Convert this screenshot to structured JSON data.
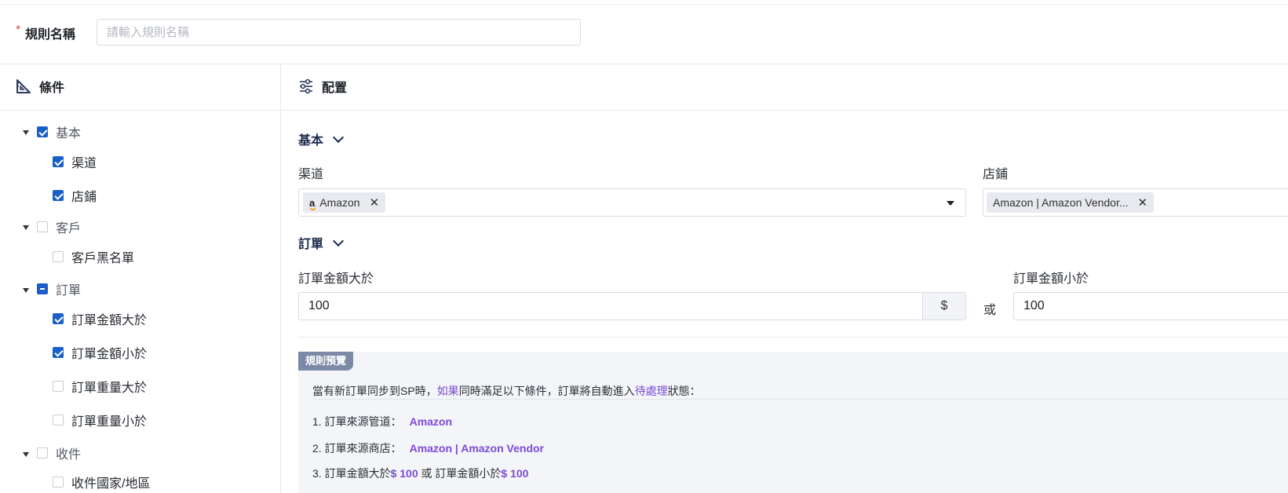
{
  "rule_name": {
    "required_mark": "*",
    "label": "規則名稱",
    "placeholder": "請輸入規則名稱",
    "value": ""
  },
  "conditions_panel": {
    "title": "條件",
    "icon": "triangle-ruler-icon"
  },
  "config_panel": {
    "title": "配置",
    "icon": "sliders-icon"
  },
  "tree": [
    {
      "label": "基本",
      "state": "checked",
      "expanded": true,
      "children": [
        {
          "label": "渠道",
          "state": "checked"
        },
        {
          "label": "店鋪",
          "state": "checked"
        }
      ]
    },
    {
      "label": "客戶",
      "state": "unchecked",
      "expanded": true,
      "children": [
        {
          "label": "客戶黑名單",
          "state": "unchecked"
        }
      ]
    },
    {
      "label": "訂單",
      "state": "indeterminate",
      "expanded": true,
      "children": [
        {
          "label": "訂單金額大於",
          "state": "checked"
        },
        {
          "label": "訂單金額小於",
          "state": "checked"
        },
        {
          "label": "訂單重量大於",
          "state": "unchecked"
        },
        {
          "label": "訂單重量小於",
          "state": "unchecked"
        }
      ]
    },
    {
      "label": "收件",
      "state": "unchecked",
      "expanded": true,
      "children": [
        {
          "label": "收件國家/地區",
          "state": "unchecked"
        }
      ]
    }
  ],
  "config": {
    "basic": {
      "title": "基本",
      "channel": {
        "label": "渠道",
        "tag": "Amazon",
        "tag_icon": "a"
      },
      "store": {
        "label": "店鋪",
        "tag": "Amazon | Amazon Vendor..."
      }
    },
    "order": {
      "title": "訂單",
      "amount_gt": {
        "label": "訂單金額大於",
        "value": "100",
        "unit": "$"
      },
      "or_text": "或",
      "amount_lt": {
        "label": "訂單金額小於",
        "value": "100"
      }
    }
  },
  "preview": {
    "badge": "規則預覽",
    "intro": {
      "p1": "當有新訂單同步到SP時，",
      "hl1": "如果",
      "p2": "同時滿足以下條件，訂單將自動進入",
      "hl2": "待處理",
      "p3": "狀態："
    },
    "line1": {
      "text": "1. 訂單來源管道：",
      "value": "Amazon"
    },
    "line2": {
      "text": "2. 訂單來源商店：",
      "value": "Amazon | Amazon Vendor"
    },
    "line3": {
      "p1": "3. 訂單金額大於",
      "v1": "$ 100",
      "p2": " 或 訂單金額小於",
      "v2": "$ 100"
    }
  }
}
